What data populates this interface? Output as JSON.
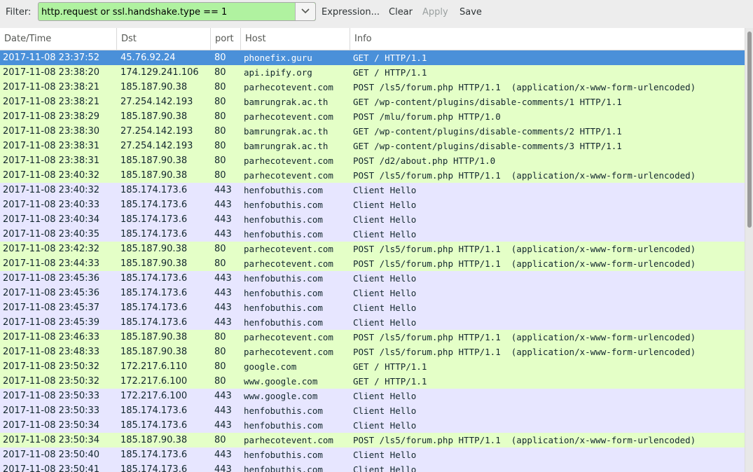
{
  "toolbar": {
    "filter_label": "Filter:",
    "filter_value": "http.request or ssl.handshake.type == 1",
    "expression_label": "Expression...",
    "clear_label": "Clear",
    "apply_label": "Apply",
    "save_label": "Save"
  },
  "columns": {
    "datetime": "Date/Time",
    "dst": "Dst",
    "port": "port",
    "host": "Host",
    "info": "Info"
  },
  "colors": {
    "filter_valid": "#b0f2a0",
    "http_row": "#e4ffc7",
    "ssl_row": "#e7e6ff",
    "selected_row": "#4a90d9"
  },
  "rows": [
    {
      "date": "2017-11-08 23:37:52",
      "dst": "45.76.92.24",
      "port": "80",
      "host": "phonefix.guru",
      "info": "GET / HTTP/1.1",
      "type": "sel"
    },
    {
      "date": "2017-11-08 23:38:20",
      "dst": "174.129.241.106",
      "port": "80",
      "host": "api.ipify.org",
      "info": "GET / HTTP/1.1",
      "type": "http"
    },
    {
      "date": "2017-11-08 23:38:21",
      "dst": "185.187.90.38",
      "port": "80",
      "host": "parhecotevent.com",
      "info": "POST /ls5/forum.php HTTP/1.1  (application/x-www-form-urlencoded)",
      "type": "http"
    },
    {
      "date": "2017-11-08 23:38:21",
      "dst": "27.254.142.193",
      "port": "80",
      "host": "bamrungrak.ac.th",
      "info": "GET /wp-content/plugins/disable-comments/1 HTTP/1.1",
      "type": "http"
    },
    {
      "date": "2017-11-08 23:38:29",
      "dst": "185.187.90.38",
      "port": "80",
      "host": "parhecotevent.com",
      "info": "POST /mlu/forum.php HTTP/1.0",
      "type": "http"
    },
    {
      "date": "2017-11-08 23:38:30",
      "dst": "27.254.142.193",
      "port": "80",
      "host": "bamrungrak.ac.th",
      "info": "GET /wp-content/plugins/disable-comments/2 HTTP/1.1",
      "type": "http"
    },
    {
      "date": "2017-11-08 23:38:31",
      "dst": "27.254.142.193",
      "port": "80",
      "host": "bamrungrak.ac.th",
      "info": "GET /wp-content/plugins/disable-comments/3 HTTP/1.1",
      "type": "http"
    },
    {
      "date": "2017-11-08 23:38:31",
      "dst": "185.187.90.38",
      "port": "80",
      "host": "parhecotevent.com",
      "info": "POST /d2/about.php HTTP/1.0",
      "type": "http"
    },
    {
      "date": "2017-11-08 23:40:32",
      "dst": "185.187.90.38",
      "port": "80",
      "host": "parhecotevent.com",
      "info": "POST /ls5/forum.php HTTP/1.1  (application/x-www-form-urlencoded)",
      "type": "http"
    },
    {
      "date": "2017-11-08 23:40:32",
      "dst": "185.174.173.6",
      "port": "443",
      "host": "henfobuthis.com",
      "info": "Client Hello",
      "type": "ssl"
    },
    {
      "date": "2017-11-08 23:40:33",
      "dst": "185.174.173.6",
      "port": "443",
      "host": "henfobuthis.com",
      "info": "Client Hello",
      "type": "ssl"
    },
    {
      "date": "2017-11-08 23:40:34",
      "dst": "185.174.173.6",
      "port": "443",
      "host": "henfobuthis.com",
      "info": "Client Hello",
      "type": "ssl"
    },
    {
      "date": "2017-11-08 23:40:35",
      "dst": "185.174.173.6",
      "port": "443",
      "host": "henfobuthis.com",
      "info": "Client Hello",
      "type": "ssl"
    },
    {
      "date": "2017-11-08 23:42:32",
      "dst": "185.187.90.38",
      "port": "80",
      "host": "parhecotevent.com",
      "info": "POST /ls5/forum.php HTTP/1.1  (application/x-www-form-urlencoded)",
      "type": "http"
    },
    {
      "date": "2017-11-08 23:44:33",
      "dst": "185.187.90.38",
      "port": "80",
      "host": "parhecotevent.com",
      "info": "POST /ls5/forum.php HTTP/1.1  (application/x-www-form-urlencoded)",
      "type": "http"
    },
    {
      "date": "2017-11-08 23:45:36",
      "dst": "185.174.173.6",
      "port": "443",
      "host": "henfobuthis.com",
      "info": "Client Hello",
      "type": "ssl"
    },
    {
      "date": "2017-11-08 23:45:36",
      "dst": "185.174.173.6",
      "port": "443",
      "host": "henfobuthis.com",
      "info": "Client Hello",
      "type": "ssl"
    },
    {
      "date": "2017-11-08 23:45:37",
      "dst": "185.174.173.6",
      "port": "443",
      "host": "henfobuthis.com",
      "info": "Client Hello",
      "type": "ssl"
    },
    {
      "date": "2017-11-08 23:45:39",
      "dst": "185.174.173.6",
      "port": "443",
      "host": "henfobuthis.com",
      "info": "Client Hello",
      "type": "ssl"
    },
    {
      "date": "2017-11-08 23:46:33",
      "dst": "185.187.90.38",
      "port": "80",
      "host": "parhecotevent.com",
      "info": "POST /ls5/forum.php HTTP/1.1  (application/x-www-form-urlencoded)",
      "type": "http"
    },
    {
      "date": "2017-11-08 23:48:33",
      "dst": "185.187.90.38",
      "port": "80",
      "host": "parhecotevent.com",
      "info": "POST /ls5/forum.php HTTP/1.1  (application/x-www-form-urlencoded)",
      "type": "http"
    },
    {
      "date": "2017-11-08 23:50:32",
      "dst": "172.217.6.110",
      "port": "80",
      "host": "google.com",
      "info": "GET / HTTP/1.1",
      "type": "http"
    },
    {
      "date": "2017-11-08 23:50:32",
      "dst": "172.217.6.100",
      "port": "80",
      "host": "www.google.com",
      "info": "GET / HTTP/1.1",
      "type": "http"
    },
    {
      "date": "2017-11-08 23:50:33",
      "dst": "172.217.6.100",
      "port": "443",
      "host": "www.google.com",
      "info": "Client Hello",
      "type": "ssl"
    },
    {
      "date": "2017-11-08 23:50:33",
      "dst": "185.174.173.6",
      "port": "443",
      "host": "henfobuthis.com",
      "info": "Client Hello",
      "type": "ssl"
    },
    {
      "date": "2017-11-08 23:50:34",
      "dst": "185.174.173.6",
      "port": "443",
      "host": "henfobuthis.com",
      "info": "Client Hello",
      "type": "ssl"
    },
    {
      "date": "2017-11-08 23:50:34",
      "dst": "185.187.90.38",
      "port": "80",
      "host": "parhecotevent.com",
      "info": "POST /ls5/forum.php HTTP/1.1  (application/x-www-form-urlencoded)",
      "type": "http"
    },
    {
      "date": "2017-11-08 23:50:40",
      "dst": "185.174.173.6",
      "port": "443",
      "host": "henfobuthis.com",
      "info": "Client Hello",
      "type": "ssl"
    },
    {
      "date": "2017-11-08 23:50:41",
      "dst": "185.174.173.6",
      "port": "443",
      "host": "henfobuthis.com",
      "info": "Client Hello",
      "type": "ssl"
    }
  ]
}
